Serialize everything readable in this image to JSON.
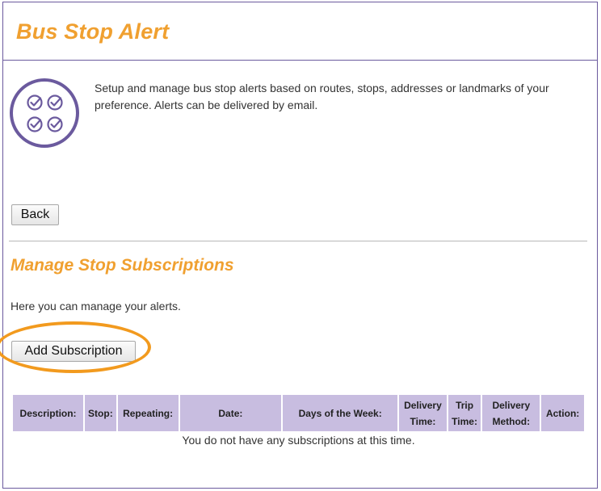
{
  "header": {
    "title": "Bus Stop Alert"
  },
  "intro": {
    "text": "Setup and manage bus stop alerts based on routes, stops, addresses or landmarks of your preference. Alerts can be delivered by email.",
    "icon": "checklist-badge-icon"
  },
  "actions": {
    "back_label": "Back",
    "add_label": "Add Subscription"
  },
  "section": {
    "title": "Manage Stop Subscriptions",
    "description": "Here you can manage your alerts."
  },
  "table": {
    "columns": [
      "Description:",
      "Stop:",
      "Repeating:",
      "Date:",
      "Days of the Week:",
      "Delivery Time:",
      "Trip Time:",
      "Delivery Method:",
      "Action:"
    ],
    "empty_message": "You do not have any subscriptions at this time."
  },
  "colors": {
    "accent": "#f0a030",
    "brand_purple": "#6b5a9e",
    "table_header": "#c8bde0",
    "highlight": "#f29a1e"
  }
}
